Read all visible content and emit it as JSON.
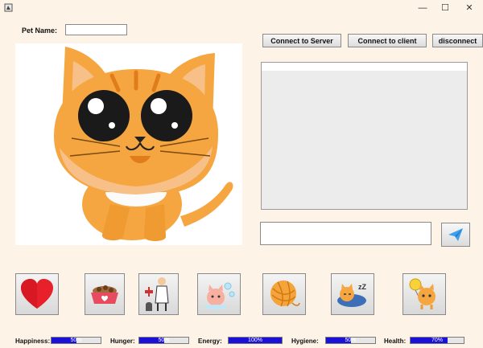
{
  "window": {
    "minimize": "—",
    "maximize": "☐",
    "close": "✕"
  },
  "pet_name": {
    "label": "Pet Name:",
    "value": ""
  },
  "buttons": {
    "connect_server": "Connect to Server",
    "connect_client": "Connect to client",
    "disconnect": "disconnect"
  },
  "chat": {
    "message_value": ""
  },
  "actions": [
    {
      "name": "heart-icon"
    },
    {
      "name": "food-bowl-icon"
    },
    {
      "name": "vet-icon"
    },
    {
      "name": "bath-icon"
    },
    {
      "name": "yarn-ball-icon"
    },
    {
      "name": "sleep-icon"
    },
    {
      "name": "play-icon"
    }
  ],
  "stats": [
    {
      "label": "Happiness:",
      "percent": 50,
      "text": "50%"
    },
    {
      "label": "Hunger:",
      "percent": 50,
      "text": "50%"
    },
    {
      "label": "Energy:",
      "percent": 100,
      "text": "100%"
    },
    {
      "label": "Hygiene:",
      "percent": 50,
      "text": "50%"
    },
    {
      "label": "Health:",
      "percent": 70,
      "text": "70%"
    }
  ],
  "colors": {
    "background": "#fdf3e6",
    "progress_fill": "#1a10d8",
    "cat_orange": "#f5a640"
  }
}
